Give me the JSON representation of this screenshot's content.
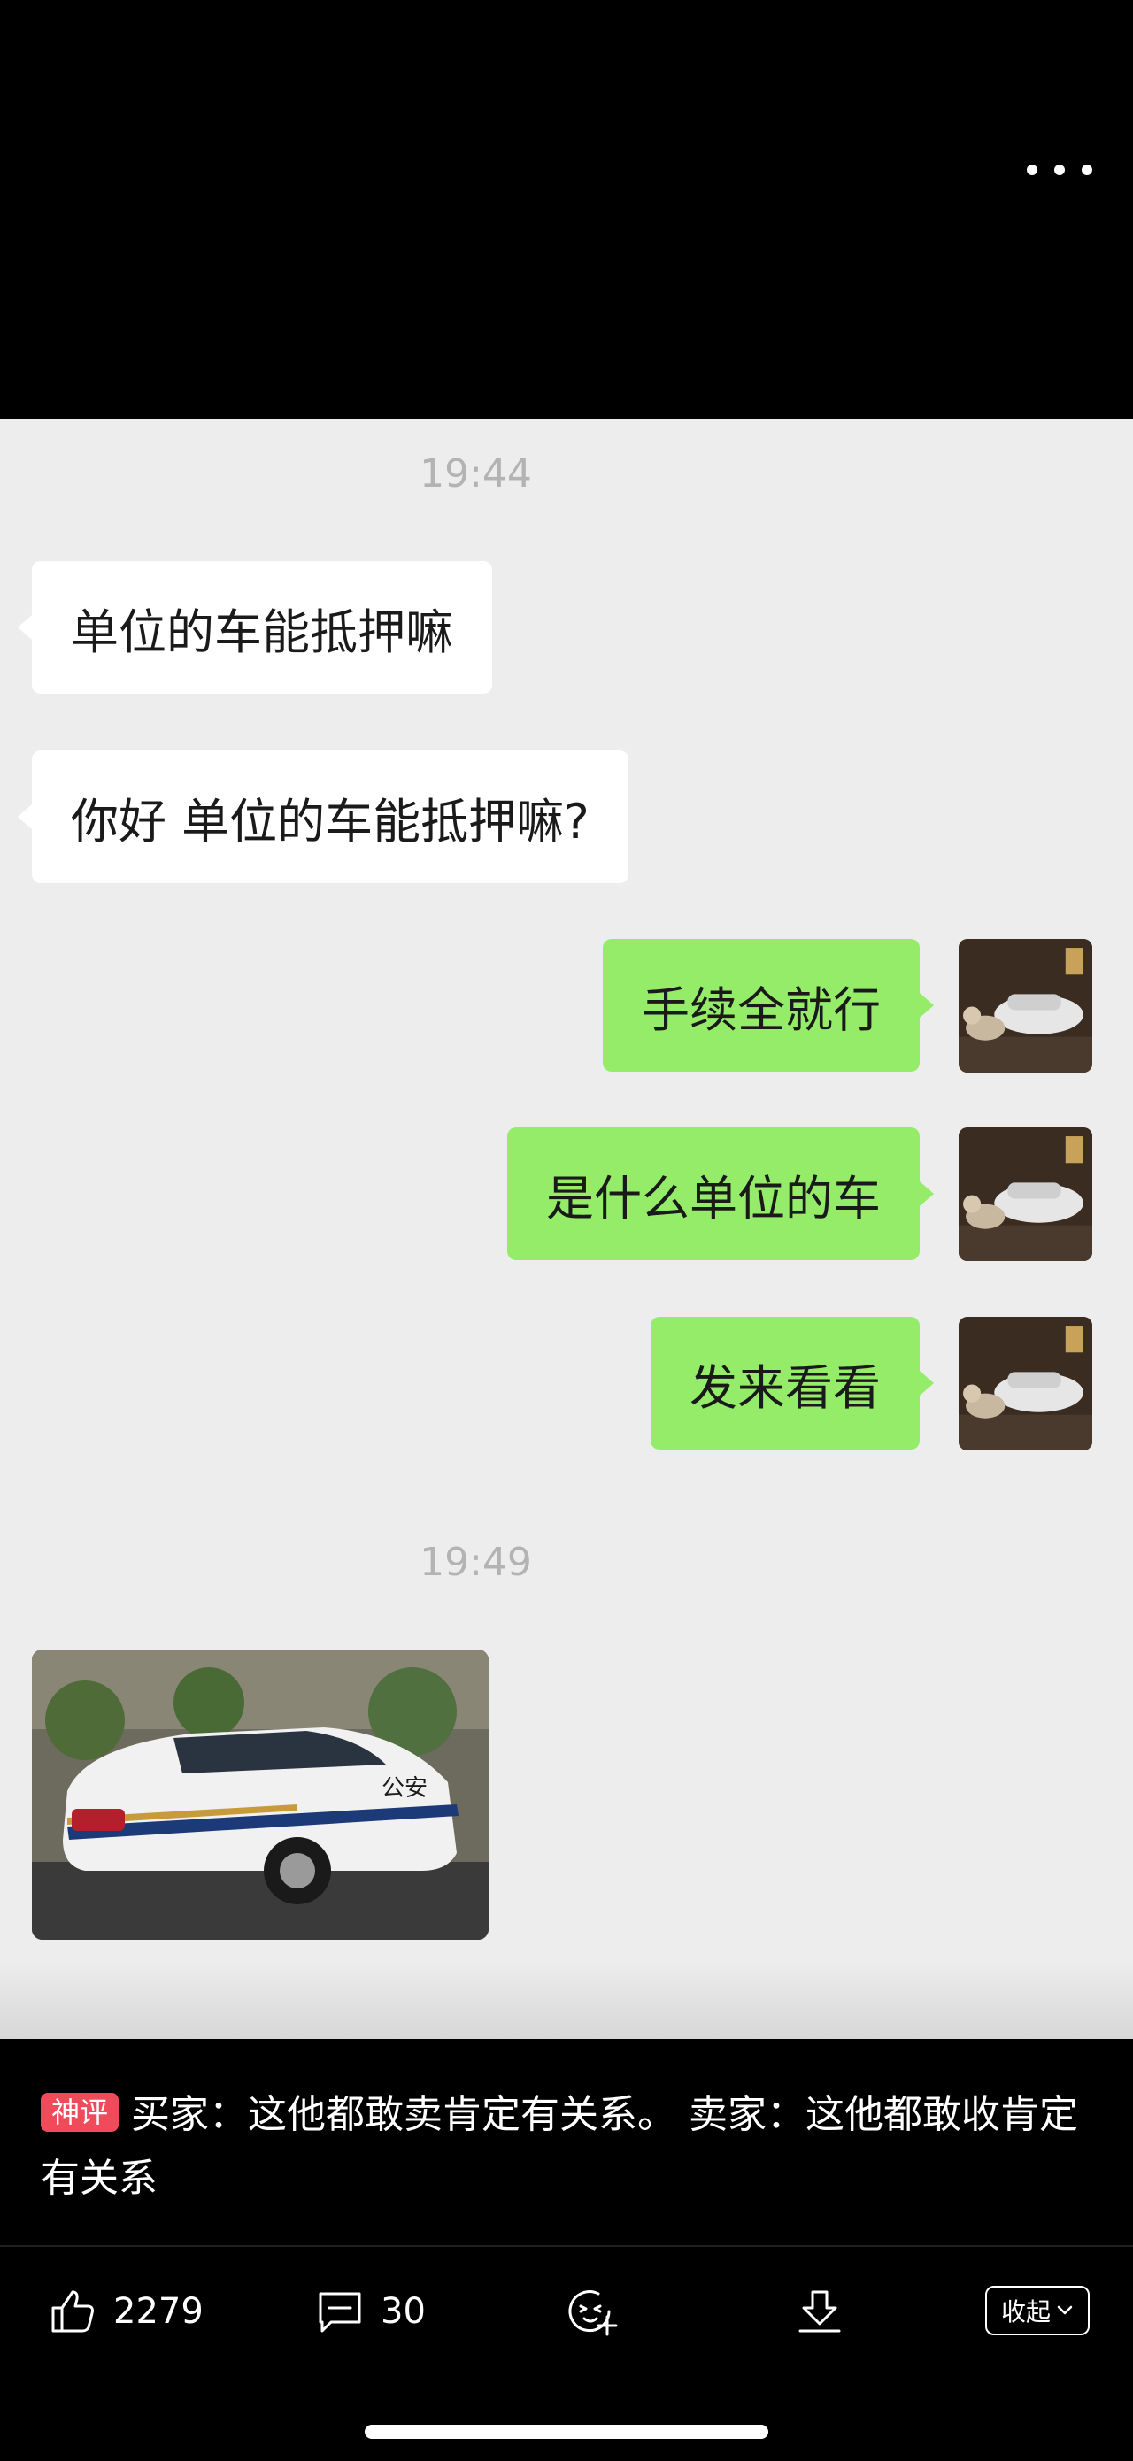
{
  "chat": {
    "timestamps": [
      "19:44",
      "19:49"
    ],
    "messages": [
      {
        "side": "in",
        "text": "单位的车能抵押嘛"
      },
      {
        "side": "in",
        "text": "你好 单位的车能抵押嘛?"
      },
      {
        "side": "out",
        "text": "手续全就行"
      },
      {
        "side": "out",
        "text": "是什么单位的车"
      },
      {
        "side": "out",
        "text": "发来看看"
      }
    ],
    "photo_text": "公安"
  },
  "comment": {
    "tag": "神评",
    "text": "买家：这他都敢卖肯定有关系。 卖家：这他都敢收肯定有关系"
  },
  "actions": {
    "likes": "2279",
    "comments": "30",
    "collapse": "收起"
  },
  "colors": {
    "chat_bg": "#ededed",
    "bubble_out": "#95ec69",
    "bubble_in": "#ffffff",
    "tag": "#ef4b5b"
  }
}
